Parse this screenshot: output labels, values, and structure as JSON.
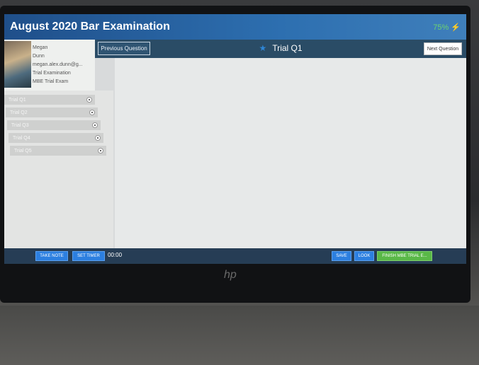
{
  "app": {
    "title": "August 2020 Bar Examination",
    "battery": "75%"
  },
  "question_bar": {
    "prev_label": "Previous Question",
    "title": "Trial Q1",
    "next_label": "Next Question"
  },
  "profile": {
    "line1": "Megan",
    "line2": "Dunn",
    "line3": "megan.alex.dunn@g...",
    "line4": "Trial Examination",
    "line5": "MBE Trial Exam"
  },
  "sidebar": {
    "items": [
      {
        "label": "Trial Q1"
      },
      {
        "label": "Trial Q2"
      },
      {
        "label": "Trial Q3"
      },
      {
        "label": "Trial Q4"
      },
      {
        "label": "Trial Q5"
      }
    ]
  },
  "footer": {
    "take_note": "TAKE NOTE",
    "set_timer": "SET TIMER",
    "timer": "00:00",
    "save": "SAVE",
    "look": "LOOK",
    "finish": "FINISH MBE TRIAL E..."
  },
  "colors": {
    "header_blue": "#2d6fb0",
    "accent_blue": "#2c7fe0",
    "finish_green": "#59b847"
  }
}
